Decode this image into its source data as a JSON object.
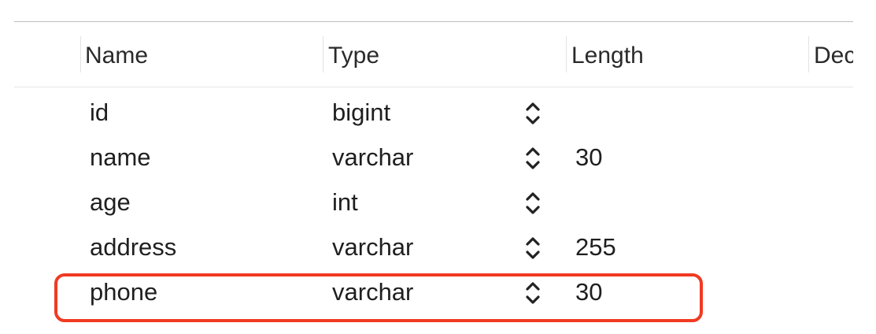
{
  "columns": {
    "name": "Name",
    "type": "Type",
    "length": "Length",
    "decimals": "Dec"
  },
  "rows": [
    {
      "name": "id",
      "type": "bigint",
      "length": ""
    },
    {
      "name": "name",
      "type": "varchar",
      "length": "30"
    },
    {
      "name": "age",
      "type": "int",
      "length": ""
    },
    {
      "name": "address",
      "type": "varchar",
      "length": "255"
    },
    {
      "name": "phone",
      "type": "varchar",
      "length": "30"
    }
  ],
  "icons": {
    "type_stepper": "up-down-chevron-icon"
  },
  "colors": {
    "highlight": "#f03a22"
  }
}
